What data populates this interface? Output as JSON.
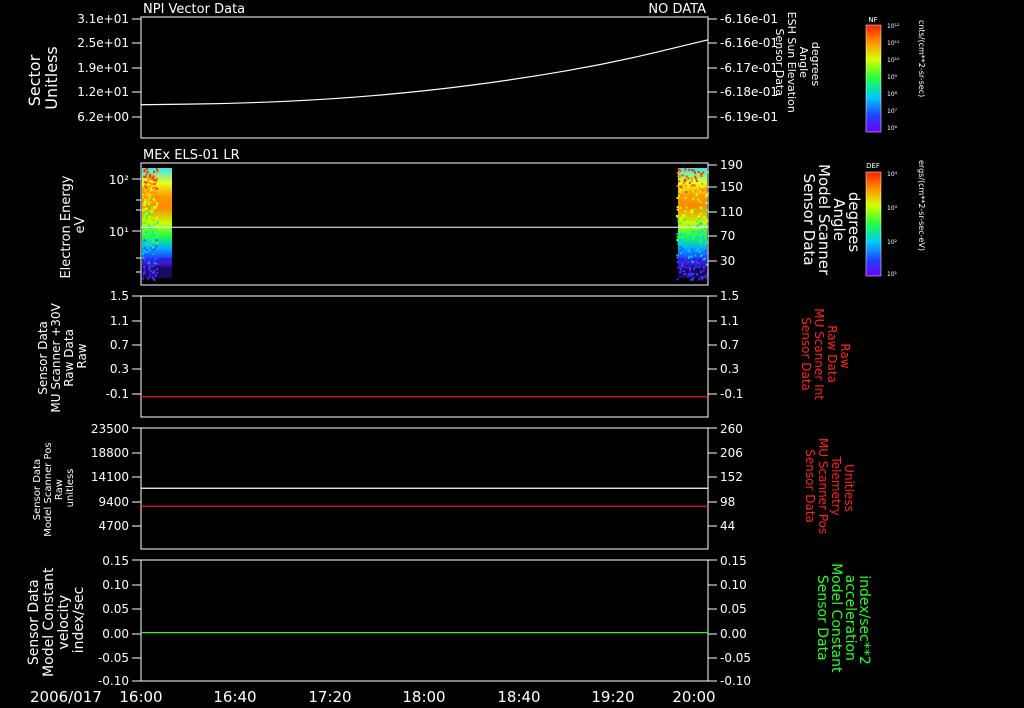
{
  "chart_data": [
    {
      "type": "line",
      "title_left": "NPI Vector Data",
      "title_right": "NO DATA",
      "ylabel_left": [
        "Sector",
        "Unitless"
      ],
      "ylabel_right": [
        "Sensor Data",
        "ESH Sun Elevation",
        "Angle",
        "degrees"
      ],
      "yticks_left": [
        "3.1e+01",
        "2.5e+01",
        "1.9e+01",
        "1.2e+01",
        "6.2e+00"
      ],
      "yticks_right": [
        "-6.16e-01",
        "-6.16e-01",
        "-6.17e-01",
        "-6.18e-01",
        "-6.19e-01"
      ],
      "ylim_right": [
        -0.6195,
        -0.6155
      ],
      "series": [
        {
          "color": "#ffffff",
          "axis": "right",
          "x": [
            "16:00",
            "16:40",
            "17:20",
            "18:00",
            "18:40",
            "19:20",
            "20:00"
          ],
          "values": [
            -0.619,
            -0.61895,
            -0.61878,
            -0.61845,
            -0.61795,
            -0.61728,
            -0.61635
          ]
        }
      ],
      "colorbar": {
        "label": "NF",
        "unit": "cnts/(cm**2-sr-sec)",
        "ticks": [
          "10¹²",
          "10¹¹",
          "10¹⁰",
          "10⁹",
          "10⁸",
          "10⁷",
          "10⁶"
        ]
      }
    },
    {
      "type": "heatmap",
      "title_left": "MEx ELS-01 LR",
      "ylabel_left": [
        "Electron Energy",
        "eV"
      ],
      "ylabel_right": [
        "Sensor Data",
        "Model Scanner",
        "Angle",
        "degrees"
      ],
      "yticks_left": [
        "10²",
        "10¹"
      ],
      "yticks_right": [
        "190",
        "150",
        "110",
        "70",
        "30"
      ],
      "ylim_right": [
        0,
        190
      ],
      "overlay_line": {
        "color": "#ffffff",
        "axis": "right",
        "value": 90
      },
      "data_intervals": [
        [
          "16:00",
          "16:07"
        ],
        [
          "19:46",
          "20:00"
        ]
      ],
      "colorbar": {
        "label": "DEF",
        "unit": "ergs/(cm**2-sr-sec-eV)",
        "ticks": [
          "10⁴",
          "10³",
          "10²",
          "10¹"
        ]
      }
    },
    {
      "type": "line",
      "ylabel_left": [
        "Sensor Data",
        "MU Scanner +30V",
        "Raw Data",
        "Raw"
      ],
      "ylabel_right": [
        "Sensor Data",
        "MU Scanner Int",
        "Raw Data",
        "Raw"
      ],
      "yticks_left": [
        "1.5",
        "1.1",
        "0.7",
        "0.3",
        "-0.1"
      ],
      "yticks_right": [
        "1.5",
        "1.1",
        "0.7",
        "0.3",
        "-0.1"
      ],
      "ylim": [
        -0.3,
        1.5
      ],
      "series": [
        {
          "color": "#ff2020",
          "axis": "left",
          "x": [
            "16:00",
            "20:00"
          ],
          "values": [
            0.0,
            0.0
          ]
        }
      ]
    },
    {
      "type": "line",
      "ylabel_left": [
        "Sensor Data",
        "Model Scanner Pos",
        "Raw",
        "unitless"
      ],
      "ylabel_right": [
        "Sensor Data",
        "MU Scanner Pos",
        "Telemetry",
        "Unitless"
      ],
      "yticks_left": [
        "23500",
        "18800",
        "14100",
        "9400",
        "4700"
      ],
      "yticks_right": [
        "260",
        "206",
        "152",
        "98",
        "44"
      ],
      "ylim_left": [
        0,
        23500
      ],
      "ylim_right": [
        0,
        260
      ],
      "series": [
        {
          "color": "#ffffff",
          "axis": "left",
          "x": [
            "16:00",
            "20:00"
          ],
          "values": [
            11800,
            11800
          ]
        },
        {
          "color": "#ff2020",
          "axis": "right",
          "x": [
            "16:00",
            "20:00"
          ],
          "values": [
            92,
            92
          ]
        }
      ]
    },
    {
      "type": "line",
      "ylabel_left": [
        "Sensor Data",
        "Model Constant",
        "velocity",
        "index/sec"
      ],
      "ylabel_right": [
        "Sensor Data",
        "Model Constant",
        "acceleration",
        "index/sec**2"
      ],
      "yticks_left": [
        "0.15",
        "0.10",
        "0.05",
        "0.00",
        "-0.05",
        "-0.10"
      ],
      "yticks_right": [
        "0.15",
        "0.10",
        "0.05",
        "0.00",
        "-0.05",
        "-0.10"
      ],
      "ylim": [
        -0.1,
        0.15
      ],
      "series": [
        {
          "color": "#20ff20",
          "axis": "left",
          "x": [
            "16:00",
            "20:00"
          ],
          "values": [
            0.0,
            0.0
          ]
        }
      ]
    }
  ],
  "x_axis": {
    "date": "2006/017",
    "ticks": [
      "16:00",
      "16:40",
      "17:20",
      "18:00",
      "18:40",
      "19:20",
      "20:00"
    ],
    "range": [
      "16:00",
      "20:00"
    ]
  },
  "colors": {
    "background": "#000000",
    "foreground": "#ffffff",
    "red": "#ff2020",
    "green": "#20ff20"
  }
}
